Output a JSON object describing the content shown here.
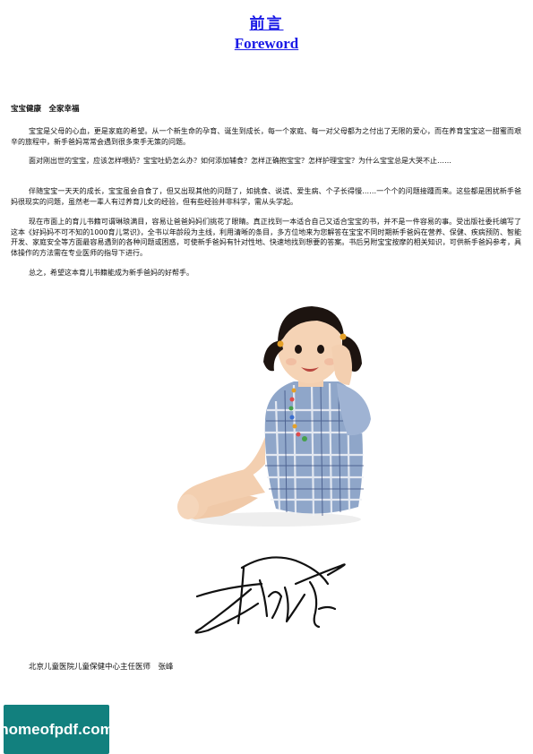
{
  "title": {
    "zh": "前言",
    "en": "Foreword"
  },
  "heading": "宝宝健康　全家幸福",
  "paragraphs": [
    "宝宝是父母的心血，更是家庭的希望。从一个新生命的孕育、诞生到成长，每一个家庭、每一对父母都为之付出了无限的爱心，而在养育宝宝这一甜蜜而艰辛的旅程中，新手爸妈常常会遇到很多束手无策的问题。",
    "面对刚出世的宝宝，应该怎样喂奶？宝宝吐奶怎么办？如何添加辅食？怎样正确抱宝宝？怎样护理宝宝？为什么宝宝总是大哭不止……",
    "伴随宝宝一天天的成长，宝宝虽会自食了，但又出现其他的问题了，如挑食、说谎、爱生病、个子长得慢……一个个的问题接踵而来。这些都是困扰新手爸妈很现实的问题，虽然老一辈人有过养育儿女的经验，但有些经验并非科学，需从头学起。",
    "现在市面上的育儿书籍可谓琳琅满目，容易让爸爸妈妈们挑花了眼睛。真正找到一本适合自己又适合宝宝的书，并不是一件容易的事。受出版社委托编写了这本《好妈妈不可不知的1000育儿常识》，全书以年龄段为主线，利用清晰的条目，多方位地来为您解答在宝宝不同时期新手爸妈在营养、保健、疾病预防、智能开发、家庭安全等方面最容易遇到的各种问题或困惑，可使新手爸妈有针对性地、快速地找到想要的答案。书后另附宝宝按摩的相关知识，可供新手爸妈参考，具体操作的方法需在专业医师的指导下进行。",
    "总之，希望这本育儿书籍能成为新手爸妈的好帮手。"
  ],
  "author": "北京儿童医院儿童保健中心主任医师　张峰",
  "watermark": "homeofpdf.com",
  "colors": {
    "title_link": "#1a1ae6",
    "watermark_bg": "#12807e"
  }
}
